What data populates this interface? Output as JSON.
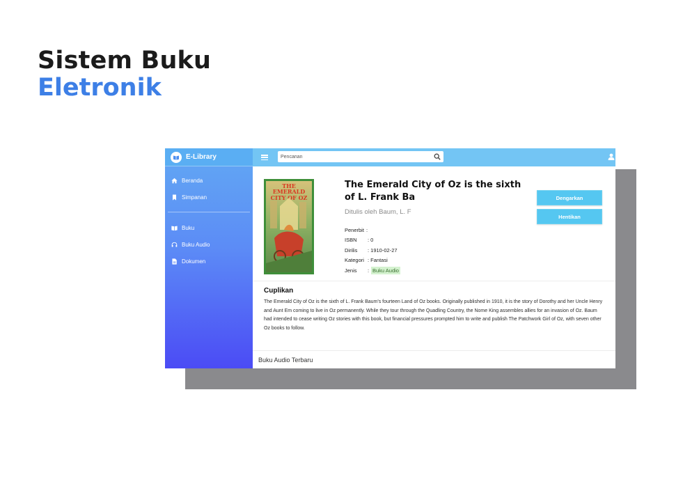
{
  "heading": {
    "line1": "Sistem Buku",
    "line2": "Eletronik"
  },
  "colors": {
    "accent": "#3d7fe6",
    "topbar": "#73c5f4",
    "sidebar_top": "#62a8f3",
    "sidebar_bottom": "#4b4bf5",
    "button": "#55c7f1",
    "shadow": "#8a8a8d"
  },
  "app": {
    "brand": {
      "name": "E-Library",
      "icon": "book-open-icon"
    },
    "search": {
      "placeholder": "Pencarian",
      "icon": "search-icon"
    },
    "topbar": {
      "menu_icon": "hamburger-icon",
      "user_icon": "user-icon"
    },
    "sidebar": {
      "items": [
        {
          "label": "Beranda",
          "icon": "home-icon"
        },
        {
          "label": "Simpanan",
          "icon": "bookmark-icon"
        },
        {
          "label": "Buku",
          "icon": "book-icon"
        },
        {
          "label": "Buku Audio",
          "icon": "headphones-icon"
        },
        {
          "label": "Dokumen",
          "icon": "document-icon"
        }
      ]
    },
    "book": {
      "cover_title": "The Emerald City of Oz",
      "title": "The Emerald City of Oz is the sixth of L. Frank Ba",
      "author": "Ditulis oleh Baum, L. F",
      "meta": {
        "publisher_label": "Penerbit",
        "publisher_sep": ":",
        "isbn_label": "ISBN",
        "isbn_value": ": 0",
        "released_label": "Dirilis",
        "released_value": ": 1910-02-27",
        "category_label": "Kategori",
        "category_value": ": Fantasi",
        "type_label": "Jenis",
        "type_sep": ":",
        "type_value": "Buku Audio"
      },
      "buttons": {
        "listen": "Dengarkan",
        "stop": "Hentikan"
      }
    },
    "excerpt": {
      "title": "Cuplikan",
      "text": "The Emerald City of Oz is the sixth of L. Frank Baum's fourteen Land of Oz books. Originally published in 1910, it is the story of Dorothy and her Uncle Henry and Aunt Em coming to live in Oz permanently. While they tour through the Quadling Country, the Nome King assembles allies for an invasion of Oz. Baum had intended to cease writing Oz stories with this book, but financial pressures prompted him to write and publish The Patchwork Girl of Oz, with seven other Oz books to follow."
    },
    "latest_audio": {
      "title": "Buku Audio Terbaru"
    }
  }
}
